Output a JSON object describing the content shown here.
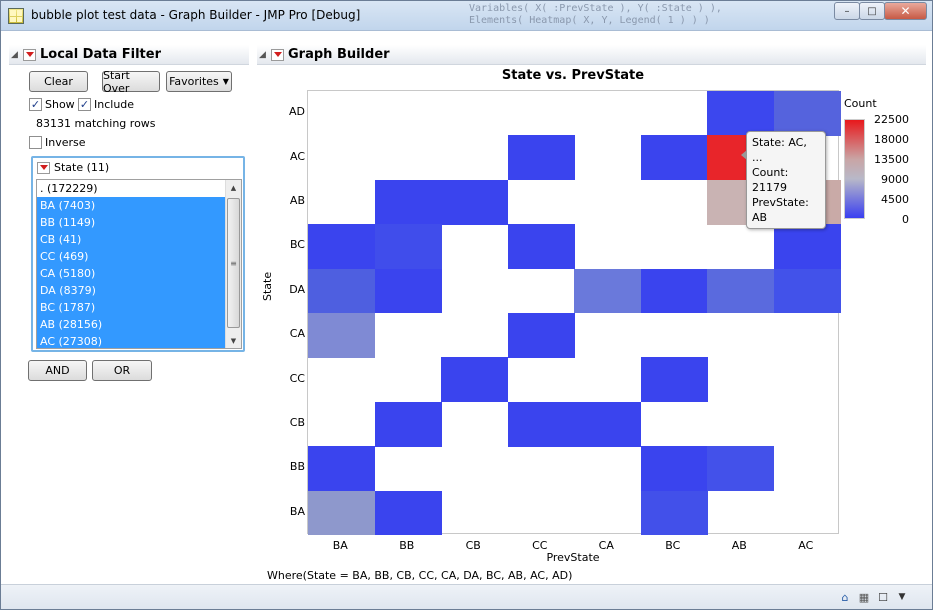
{
  "window": {
    "title": "bubble plot test data - Graph Builder - JMP Pro [Debug]",
    "ghost_text": "Variables( X( :PrevState ), Y( :State ) ),\nElements( Heatmap( X, Y, Legend( 1 ) ) )",
    "buttons": {
      "minimize": "–",
      "maximize": "□",
      "close": "✕"
    }
  },
  "filter": {
    "header": "Local Data Filter",
    "clear_label": "Clear",
    "start_over_label": "Start Over",
    "favorites_label": "Favorites",
    "show_label": "Show",
    "include_label": "Include",
    "matching_rows": "83131 matching rows",
    "inverse_label": "Inverse",
    "show_checked": true,
    "include_checked": true,
    "inverse_checked": false,
    "state_header": "State (11)",
    "items": [
      {
        "label": ". (172229)",
        "selected": false
      },
      {
        "label": "BA (7403)",
        "selected": true
      },
      {
        "label": "BB (1149)",
        "selected": true
      },
      {
        "label": "CB (41)",
        "selected": true
      },
      {
        "label": "CC (469)",
        "selected": true
      },
      {
        "label": "CA (5180)",
        "selected": true
      },
      {
        "label": "DA (8379)",
        "selected": true
      },
      {
        "label": "BC (1787)",
        "selected": true
      },
      {
        "label": "AB (28156)",
        "selected": true
      },
      {
        "label": "AC (27308)",
        "selected": true
      }
    ],
    "and_label": "AND",
    "or_label": "OR"
  },
  "graph_builder": {
    "header": "Graph Builder",
    "where_clause": "Where(State = BA, BB, CB, CC, CA, DA, BC, AB, AC, AD)",
    "tooltip": {
      "line1": "State: AC, ...",
      "line2": "Count: 21179",
      "line3": "PrevState: AB"
    }
  },
  "chart_data": {
    "type": "heatmap",
    "title": "State vs. PrevState",
    "xlabel": "PrevState",
    "ylabel": "State",
    "x_categories": [
      "BA",
      "BB",
      "CB",
      "CC",
      "CA",
      "BC",
      "AB",
      "AC"
    ],
    "y_categories": [
      "AD",
      "AC",
      "AB",
      "BC",
      "DA",
      "CA",
      "CC",
      "CB",
      "BB",
      "BA"
    ],
    "legend": {
      "title": "Count",
      "ticks": [
        "22500",
        "18000",
        "13500",
        "9000",
        "4500",
        "0"
      ],
      "range": [
        0,
        22500
      ],
      "colors": {
        "high": "#e8181c",
        "mid": "#c0b8c0",
        "low": "#3a3ff0"
      }
    },
    "cells": [
      {
        "y": "AD",
        "x": "AB",
        "color": "#3c47ee"
      },
      {
        "y": "AD",
        "x": "AC",
        "color": "#5563dd"
      },
      {
        "y": "AC",
        "x": "CC",
        "color": "#3a44ee"
      },
      {
        "y": "AC",
        "x": "BC",
        "color": "#3a44ee"
      },
      {
        "y": "AC",
        "x": "AB",
        "color": "#e8252a",
        "count": 21179
      },
      {
        "y": "AB",
        "x": "BB",
        "color": "#3a44ee"
      },
      {
        "y": "AB",
        "x": "CB",
        "color": "#3a44ee"
      },
      {
        "y": "AB",
        "x": "AB",
        "color": "#c9b3b3"
      },
      {
        "y": "AB",
        "x": "AC",
        "color": "#c9aaa7"
      },
      {
        "y": "BC",
        "x": "BA",
        "color": "#3a44ee"
      },
      {
        "y": "BC",
        "x": "BB",
        "color": "#404deb"
      },
      {
        "y": "BC",
        "x": "CC",
        "color": "#3a44ee"
      },
      {
        "y": "BC",
        "x": "AC",
        "color": "#3a44ee"
      },
      {
        "y": "DA",
        "x": "BA",
        "color": "#4e5fe0"
      },
      {
        "y": "DA",
        "x": "BB",
        "color": "#3a44ee"
      },
      {
        "y": "DA",
        "x": "CA",
        "color": "#6a79db"
      },
      {
        "y": "DA",
        "x": "BC",
        "color": "#3a44ee"
      },
      {
        "y": "DA",
        "x": "AB",
        "color": "#5a6ade"
      },
      {
        "y": "DA",
        "x": "AC",
        "color": "#4252ea"
      },
      {
        "y": "CA",
        "x": "BA",
        "color": "#7f8ad4"
      },
      {
        "y": "CA",
        "x": "CC",
        "color": "#3a44ee"
      },
      {
        "y": "CC",
        "x": "CB",
        "color": "#3a44ee"
      },
      {
        "y": "CC",
        "x": "BC",
        "color": "#3a44ee"
      },
      {
        "y": "CB",
        "x": "BB",
        "color": "#3a44ee"
      },
      {
        "y": "CB",
        "x": "CC",
        "color": "#3a44ee"
      },
      {
        "y": "CB",
        "x": "CA",
        "color": "#3a44ee"
      },
      {
        "y": "BB",
        "x": "BA",
        "color": "#3a44ee"
      },
      {
        "y": "BB",
        "x": "BC",
        "color": "#3a44ee"
      },
      {
        "y": "BB",
        "x": "AB",
        "color": "#4351ea"
      },
      {
        "y": "BA",
        "x": "BA",
        "color": "#8e98cc"
      },
      {
        "y": "BA",
        "x": "BB",
        "color": "#3a44ee"
      },
      {
        "y": "BA",
        "x": "BC",
        "color": "#4250ea"
      }
    ]
  },
  "statusbar": {
    "icons": [
      "home-icon",
      "checkbox-icon",
      "dropdown-icon"
    ]
  }
}
